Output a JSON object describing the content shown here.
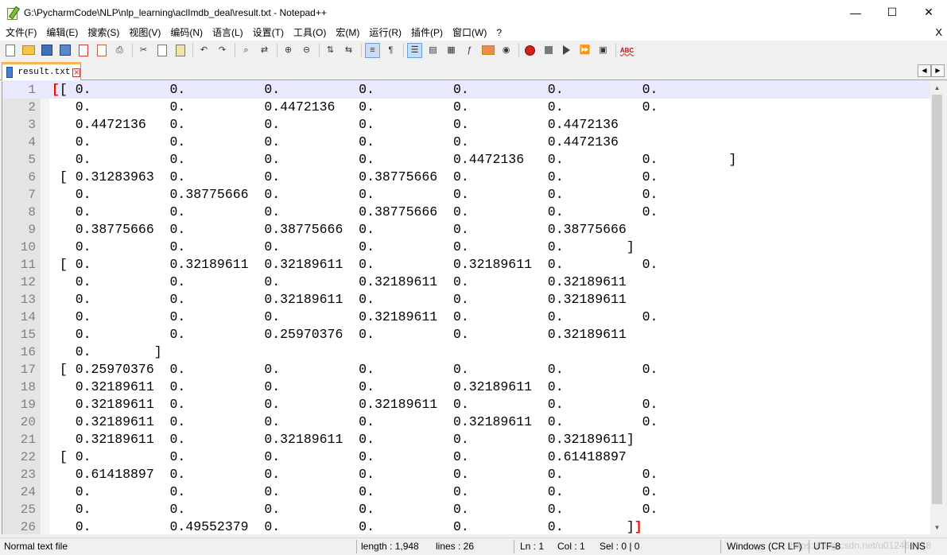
{
  "window": {
    "title": "G:\\PycharmCode\\NLP\\nlp_learning\\aclImdb_deal\\result.txt - Notepad++",
    "minimize": "—",
    "maximize": "☐",
    "close": "✕"
  },
  "menu": {
    "items": [
      "文件(F)",
      "编辑(E)",
      "搜索(S)",
      "视图(V)",
      "编码(N)",
      "语言(L)",
      "设置(T)",
      "工具(O)",
      "宏(M)",
      "运行(R)",
      "插件(P)",
      "窗口(W)",
      "?"
    ],
    "close": "X"
  },
  "toolbar": {
    "spell_label": "ABC",
    "icons": [
      "new-file-icon",
      "open-file-icon",
      "save-icon",
      "save-all-icon",
      "close-icon",
      "close-all-icon",
      "print-icon",
      "cut-icon",
      "copy-icon",
      "paste-icon",
      "undo-icon",
      "redo-icon",
      "find-icon",
      "replace-icon",
      "zoom-in-icon",
      "zoom-out-icon",
      "sync-vertical-icon",
      "sync-horizontal-icon",
      "word-wrap-icon",
      "show-all-chars-icon",
      "indent-guide-icon",
      "udl-icon",
      "doc-map-icon",
      "function-list-icon",
      "folder-workspace-icon",
      "monitoring-icon",
      "record-macro-icon",
      "stop-record-icon",
      "play-macro-icon",
      "play-multiple-icon",
      "save-macro-icon",
      "spell-check-icon"
    ]
  },
  "tab": {
    "label": "result.txt",
    "close": "✕"
  },
  "editor": {
    "lines": [
      "[[ 0.          0.          0.          0.          0.          0.          0.",
      "   0.          0.          0.4472136   0.          0.          0.          0.",
      "   0.4472136   0.          0.          0.          0.          0.4472136",
      "   0.          0.          0.          0.          0.          0.4472136",
      "   0.          0.          0.          0.          0.4472136   0.          0.         ]",
      " [ 0.31283963  0.          0.          0.38775666  0.          0.          0.",
      "   0.          0.38775666  0.          0.          0.          0.          0.",
      "   0.          0.          0.          0.38775666  0.          0.          0.",
      "   0.38775666  0.          0.38775666  0.          0.          0.38775666",
      "   0.          0.          0.          0.          0.          0.        ]",
      " [ 0.          0.32189611  0.32189611  0.          0.32189611  0.          0.",
      "   0.          0.          0.          0.32189611  0.          0.32189611",
      "   0.          0.          0.32189611  0.          0.          0.32189611",
      "   0.          0.          0.          0.32189611  0.          0.          0.",
      "   0.          0.          0.25970376  0.          0.          0.32189611",
      "   0.        ]",
      " [ 0.25970376  0.          0.          0.          0.          0.          0.",
      "   0.32189611  0.          0.          0.          0.32189611  0.",
      "   0.32189611  0.          0.          0.32189611  0.          0.          0.",
      "   0.32189611  0.          0.          0.          0.32189611  0.          0.",
      "   0.32189611  0.          0.32189611  0.          0.          0.32189611]",
      " [ 0.          0.          0.          0.          0.          0.61418897",
      "   0.61418897  0.          0.          0.          0.          0.          0.",
      "   0.          0.          0.          0.          0.          0.          0.",
      "   0.          0.          0.          0.          0.          0.          0.",
      "   0.          0.49552379  0.          0.          0.          0.        ]]"
    ]
  },
  "status": {
    "file_type": "Normal text file",
    "length": "length : 1,948",
    "lines": "lines : 26",
    "ln": "Ln : 1",
    "col": "Col : 1",
    "sel": "Sel : 0 | 0",
    "eol": "Windows (CR LF)",
    "encoding": "UTF-8",
    "mode": "INS",
    "watermark": "https://blog.csdn.net/u012468678"
  },
  "colors": {
    "current_line": "#e8e8ff",
    "brace_match": "#ff0000",
    "tab_accent": "#fab450"
  }
}
